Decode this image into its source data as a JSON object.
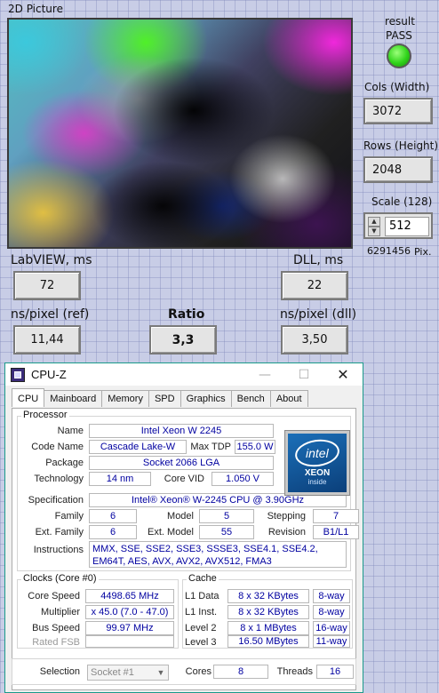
{
  "labview": {
    "picture_label": "2D Picture",
    "result_label": "result",
    "result_status": "PASS",
    "cols_label": "Cols (Width)",
    "cols_value": "3072",
    "rows_label": "Rows (Height)",
    "rows_value": "2048",
    "scale_label": "Scale (128)",
    "scale_value": "512",
    "pixels_value": "6291456",
    "pixels_unit": "Pix.",
    "labview_ms_label": "LabVIEW, ms",
    "labview_ms_value": "72",
    "dll_ms_label": "DLL, ms",
    "dll_ms_value": "22",
    "ns_ref_label": "ns/pixel (ref)",
    "ns_ref_value": "11,44",
    "ratio_label": "Ratio",
    "ratio_value": "3,3",
    "ns_dll_label": "ns/pixel (dll)",
    "ns_dll_value": "3,50",
    "led_color": "#2fd41a"
  },
  "cpuz": {
    "title": "CPU-Z",
    "window_buttons": {
      "minimize": "—",
      "maximize": "☐",
      "close": "✕"
    },
    "tabs": [
      "CPU",
      "Mainboard",
      "Memory",
      "SPD",
      "Graphics",
      "Bench",
      "About"
    ],
    "processor": {
      "group_title": "Processor",
      "name_label": "Name",
      "name": "Intel Xeon W 2245",
      "codename_label": "Code Name",
      "codename": "Cascade Lake-W",
      "maxtdp_label": "Max TDP",
      "maxtdp": "155.0 W",
      "package_label": "Package",
      "package": "Socket 2066 LGA",
      "technology_label": "Technology",
      "technology": "14 nm",
      "corevid_label": "Core VID",
      "corevid": "1.050 V",
      "spec_label": "Specification",
      "spec": "Intel® Xeon® W-2245 CPU @ 3.90GHz",
      "family_label": "Family",
      "family": "6",
      "model_label": "Model",
      "model": "5",
      "stepping_label": "Stepping",
      "stepping": "7",
      "extfamily_label": "Ext. Family",
      "extfamily": "6",
      "extmodel_label": "Ext. Model",
      "extmodel": "55",
      "revision_label": "Revision",
      "revision": "B1/L1",
      "instructions_label": "Instructions",
      "instructions": "MMX, SSE, SSE2, SSE3, SSSE3, SSE4.1, SSE4.2, EM64T, AES, AVX, AVX2, AVX512, FMA3"
    },
    "logo": {
      "brand": "intel",
      "line": "XEON",
      "tag": "inside"
    },
    "clocks": {
      "group_title": "Clocks (Core #0)",
      "corespeed_label": "Core Speed",
      "corespeed": "4498.65 MHz",
      "multiplier_label": "Multiplier",
      "multiplier": "x 45.0 (7.0 - 47.0)",
      "busspeed_label": "Bus Speed",
      "busspeed": "99.97 MHz",
      "ratedfsb_label": "Rated FSB",
      "ratedfsb": ""
    },
    "cache": {
      "group_title": "Cache",
      "l1d_label": "L1 Data",
      "l1d": "8 x 32 KBytes",
      "l1d_way": "8-way",
      "l1i_label": "L1 Inst.",
      "l1i": "8 x 32 KBytes",
      "l1i_way": "8-way",
      "l2_label": "Level 2",
      "l2": "8 x 1 MBytes",
      "l2_way": "16-way",
      "l3_label": "Level 3",
      "l3": "16.50 MBytes",
      "l3_way": "11-way"
    },
    "bottom": {
      "selection_label": "Selection",
      "selection": "Socket #1",
      "cores_label": "Cores",
      "cores": "8",
      "threads_label": "Threads",
      "threads": "16"
    }
  }
}
